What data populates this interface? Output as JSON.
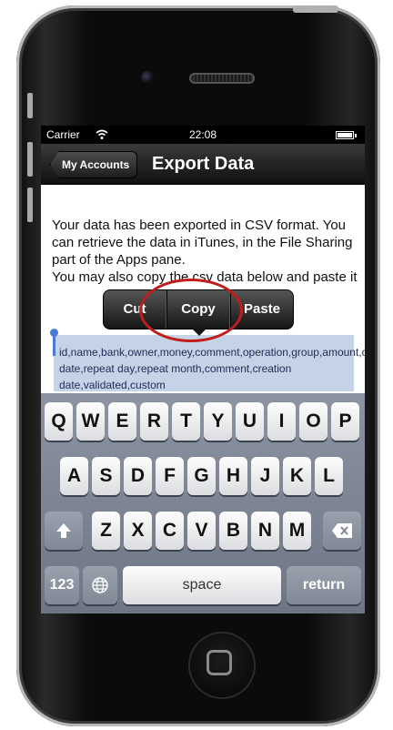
{
  "status": {
    "carrier": "Carrier",
    "time": "22:08"
  },
  "nav": {
    "back_label": "My Accounts",
    "title": "Export Data"
  },
  "content": {
    "para1": "Your data has been exported in CSV format. You can retrieve the data in iTunes, in the File Sharing part of the Apps pane.",
    "para2": "You may also copy the csv data below and paste it"
  },
  "csv_text": "id,name,bank,owner,money,comment,operation,group,amount,operation date,repeat day,repeat month,comment,creation date,validated,custom",
  "edit_menu": {
    "cut": "Cut",
    "copy": "Copy",
    "paste": "Paste"
  },
  "keyboard": {
    "row1": [
      "Q",
      "W",
      "E",
      "R",
      "T",
      "Y",
      "U",
      "I",
      "O",
      "P"
    ],
    "row2": [
      "A",
      "S",
      "D",
      "F",
      "G",
      "H",
      "J",
      "K",
      "L"
    ],
    "row3": [
      "Z",
      "X",
      "C",
      "V",
      "B",
      "N",
      "M"
    ],
    "numbers_label": "123",
    "space_label": "space",
    "return_label": "return"
  },
  "icons": {
    "wifi": "wifi-icon",
    "battery": "battery-icon",
    "shift": "shift-icon",
    "delete": "delete-icon",
    "globe": "globe-icon",
    "home": "home-button-icon"
  }
}
